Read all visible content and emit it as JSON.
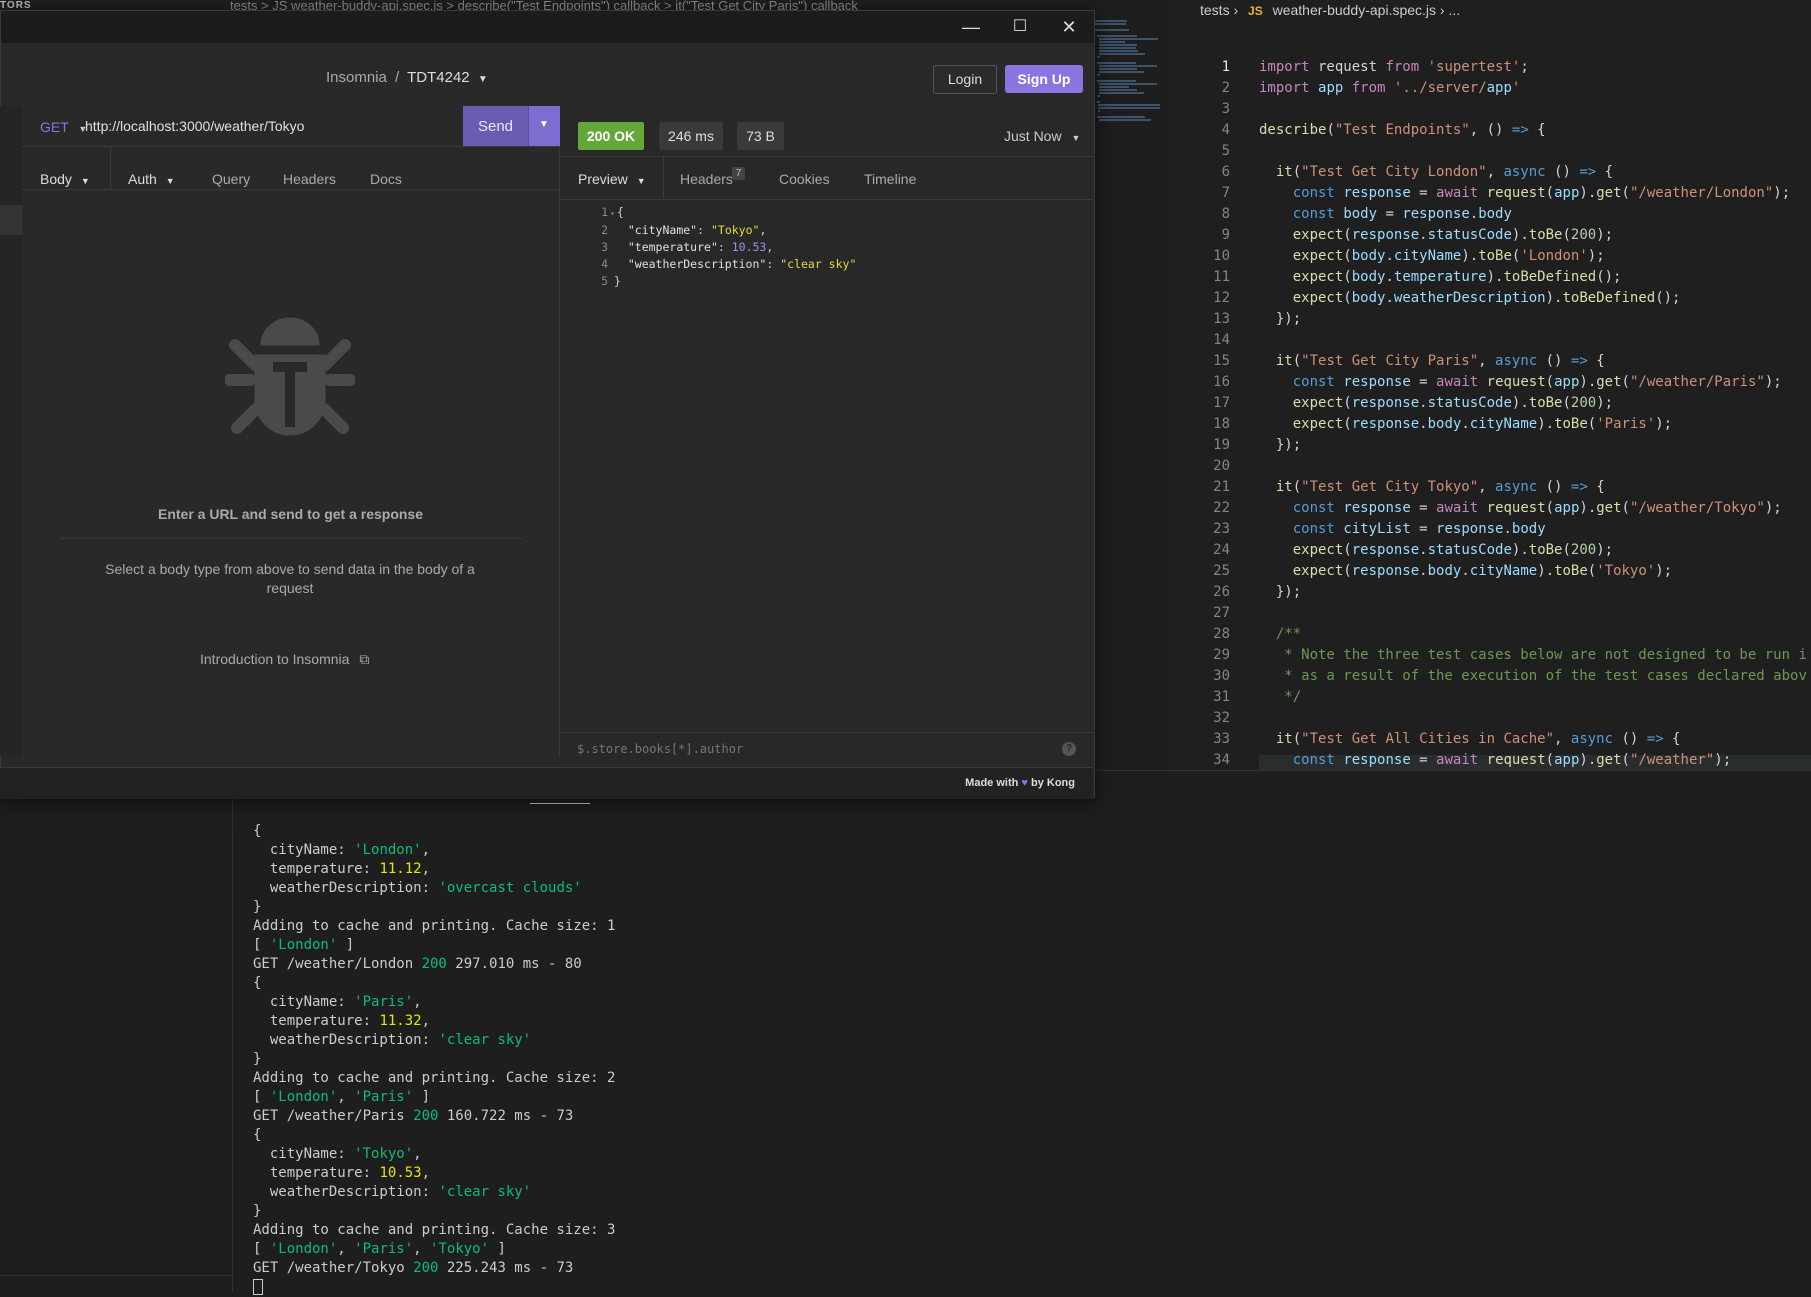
{
  "vscode": {
    "explorer_title": "TORS",
    "top_breadcrumb": "tests  >  JS weather-buddy-api.spec.js  >  describe(\"Test Endpoints\") callback  >  it(\"Test Get City Paris\") callback",
    "editor_breadcrumb": {
      "folder": "tests",
      "file_icon": "JS",
      "file": "weather-buddy-api.spec.js",
      "more": "..."
    },
    "code_lines": [
      "import request from 'supertest';",
      "import app from '../server/app'",
      "",
      "describe(\"Test Endpoints\", () => {",
      "",
      "  it(\"Test Get City London\", async () => {",
      "    const response = await request(app).get(\"/weather/London\");",
      "    const body = response.body",
      "    expect(response.statusCode).toBe(200);",
      "    expect(body.cityName).toBe('London');",
      "    expect(body.temperature).toBeDefined();",
      "    expect(body.weatherDescription).toBeDefined();",
      "  });",
      "",
      "  it(\"Test Get City Paris\", async () => {",
      "    const response = await request(app).get(\"/weather/Paris\");",
      "    expect(response.statusCode).toBe(200);",
      "    expect(response.body.cityName).toBe('Paris');",
      "  });",
      "",
      "  it(\"Test Get City Tokyo\", async () => {",
      "    const response = await request(app).get(\"/weather/Tokyo\");",
      "    const cityList = response.body",
      "    expect(response.statusCode).toBe(200);",
      "    expect(response.body.cityName).toBe('Tokyo');",
      "  });",
      "",
      "  /**",
      "   * Note the three test cases below are not designed to be run i",
      "   * as a result of the execution of the test cases declared abov",
      "   */",
      "",
      "  it(\"Test Get All Cities in Cache\", async () => {",
      "    const response = await request(app).get(\"/weather\");"
    ],
    "terminal_lines": [
      "{",
      "  cityName: 'London',",
      "  temperature: 11.12,",
      "  weatherDescription: 'overcast clouds'",
      "}",
      "Adding to cache and printing. Cache size: 1",
      "[ 'London' ]",
      "GET /weather/London 200 297.010 ms - 80",
      "{",
      "  cityName: 'Paris',",
      "  temperature: 11.32,",
      "  weatherDescription: 'clear sky'",
      "}",
      "Adding to cache and printing. Cache size: 2",
      "[ 'London', 'Paris' ]",
      "GET /weather/Paris 200 160.722 ms - 73",
      "{",
      "  cityName: 'Tokyo',",
      "  temperature: 10.53,",
      "  weatherDescription: 'clear sky'",
      "}",
      "Adding to cache and printing. Cache size: 3",
      "[ 'London', 'Paris', 'Tokyo' ]",
      "GET /weather/Tokyo 200 225.243 ms - 73"
    ]
  },
  "insomnia": {
    "window_controls": {
      "minimize": "—",
      "maximize": "☐",
      "close": "✕"
    },
    "breadcrumb": {
      "app": "Insomnia",
      "separator": "/",
      "project": "TDT4242"
    },
    "login_label": "Login",
    "signup_label": "Sign Up",
    "request": {
      "method": "GET",
      "url": "http://localhost:3000/weather/Tokyo",
      "send_label": "Send",
      "tabs": {
        "body": "Body",
        "auth": "Auth",
        "query": "Query",
        "headers": "Headers",
        "docs": "Docs"
      },
      "empty_title": "Enter a URL and send to get a response",
      "empty_body": "Select a body type from above to send data in the body of a request",
      "intro_link": "Introduction to Insomnia"
    },
    "response": {
      "status": "200 OK",
      "time": "246 ms",
      "size": "73 B",
      "timestamp": "Just Now",
      "tabs": {
        "preview": "Preview",
        "headers": "Headers",
        "headers_count": "7",
        "cookies": "Cookies",
        "timeline": "Timeline"
      },
      "json_lines": [
        "{",
        "  \"cityName\": \"Tokyo\",",
        "  \"temperature\": 10.53,",
        "  \"weatherDescription\": \"clear sky\"",
        "}"
      ],
      "filter_placeholder": "$.store.books[*].author"
    },
    "footer": {
      "made_with": "Made with",
      "by": "by Kong"
    }
  },
  "colors": {
    "accent": "#8c74e0",
    "status_ok": "#65a83a"
  }
}
